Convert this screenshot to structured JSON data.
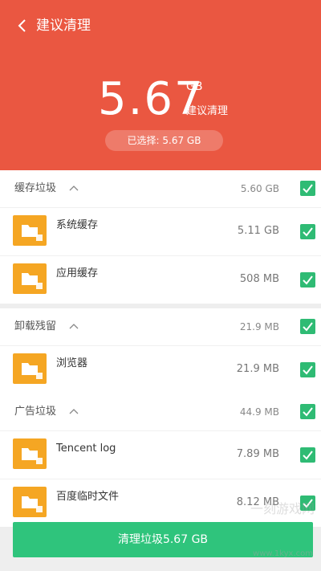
{
  "header": {
    "title": "建议清理",
    "total": "5.67",
    "unit": "GB",
    "subtitle": "建议清理",
    "selected": "已选择: 5.67 GB",
    "back_icon": "chevron-left-icon"
  },
  "sections": [
    {
      "name": "缓存垃圾",
      "size": "5.60 GB",
      "checked": true,
      "items": [
        {
          "name": "系统缓存",
          "size": "5.11 GB",
          "checked": true
        },
        {
          "name": "应用缓存",
          "size": "508 MB",
          "checked": true
        }
      ]
    },
    {
      "name": "卸载残留",
      "size": "21.9 MB",
      "checked": true,
      "items": [
        {
          "name": "浏览器",
          "size": "21.9 MB",
          "checked": true
        }
      ]
    },
    {
      "name": "广告垃圾",
      "size": "44.9 MB",
      "checked": true,
      "items": [
        {
          "name": "Tencent log",
          "size": "7.89 MB",
          "checked": true
        },
        {
          "name": "百度临时文件",
          "size": "8.12 MB",
          "checked": true
        }
      ]
    }
  ],
  "clean_button": "清理垃圾5.67 GB",
  "watermark": {
    "text": "一刻游戏网",
    "url": "www.1kyx.com"
  },
  "colors": {
    "header": "#ea5741",
    "accent": "#2fc47c",
    "folder": "#f5a623"
  }
}
